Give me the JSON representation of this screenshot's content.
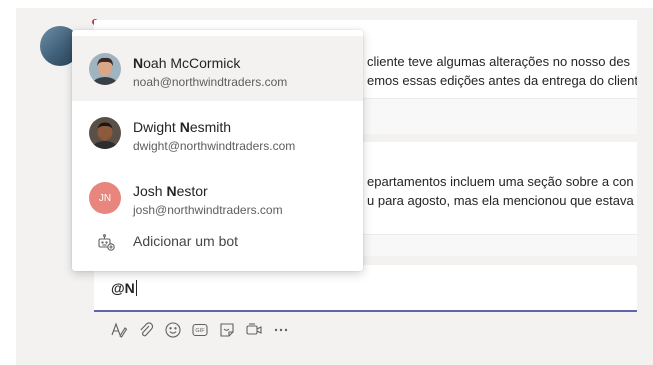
{
  "thread": {
    "post1_line1": "cliente teve algumas alterações no nosso des",
    "post1_line2": "emos essas edições antes da entrega do client",
    "post2_line1": "epartamentos incluem uma seção sobre a con",
    "post2_line2": "u para agosto, mas ela mencionou que estava"
  },
  "mention_list": {
    "items": [
      {
        "name_bold": "N",
        "name_rest": "oah McCormick",
        "email": "noah@northwindtraders.com",
        "selected": true
      },
      {
        "name_pre": "Dwight ",
        "name_bold": "N",
        "name_rest": "esmith",
        "email": "dwight@northwindtraders.com"
      },
      {
        "name_pre": "Josh ",
        "name_bold": "N",
        "name_rest": "estor",
        "email": "josh@northwindtraders.com",
        "initials": "JN"
      }
    ],
    "add_bot_label": "Adicionar um bot"
  },
  "compose": {
    "text": "@N"
  },
  "toolbar": {
    "icons": [
      "format-icon",
      "attach-icon",
      "emoji-icon",
      "gif-icon",
      "sticker-icon",
      "meet-now-icon",
      "more-options-icon"
    ]
  },
  "colors": {
    "accent": "#6264a7",
    "initials_bg": "#e8857c",
    "background": "#f3f2f1"
  }
}
